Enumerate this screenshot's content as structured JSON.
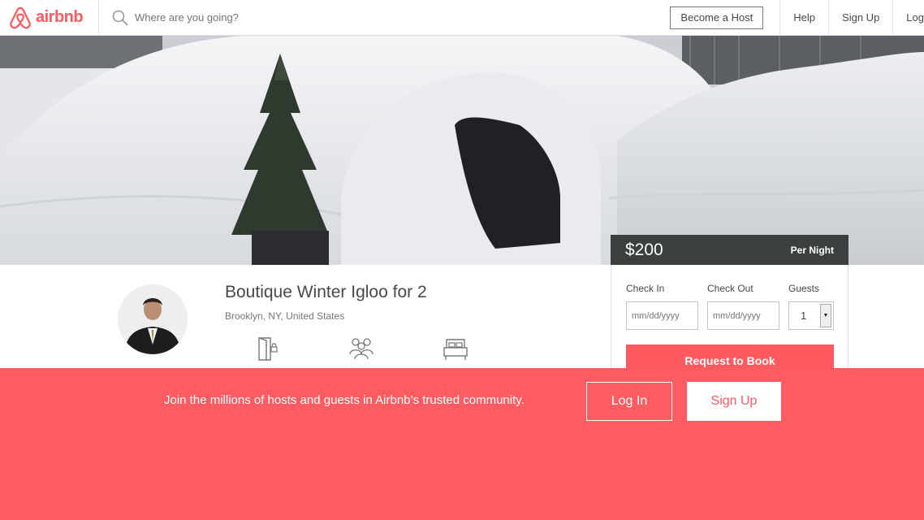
{
  "header": {
    "logo_text": "airbnb",
    "search_placeholder": "Where are you going?",
    "become_host": "Become a Host",
    "help": "Help",
    "sign_up": "Sign Up",
    "log_in_partial": "Log"
  },
  "hero": {
    "image_subject": "snow-igloo-photo"
  },
  "booking": {
    "price": "$200",
    "per_night": "Per Night",
    "check_in_label": "Check In",
    "check_out_label": "Check Out",
    "guests_label": "Guests",
    "check_in_placeholder": "mm/dd/yyyy",
    "check_out_placeholder": "mm/dd/yyyy",
    "guests_value": "1",
    "request_button": "Request to Book"
  },
  "listing": {
    "title": "Boutique Winter Igloo for 2",
    "location": "Brooklyn, NY, United States",
    "amenity_icons": [
      "door-icon",
      "guests-icon",
      "bed-icon"
    ]
  },
  "signup_banner": {
    "message": "Join the millions of hosts and guests in Airbnb’s trusted community.",
    "login_button": "Log In",
    "signup_button": "Sign Up"
  },
  "colors": {
    "brand": "#ff5a5f",
    "banner": "#fd5c63",
    "price_bar": "#3c3f40"
  }
}
